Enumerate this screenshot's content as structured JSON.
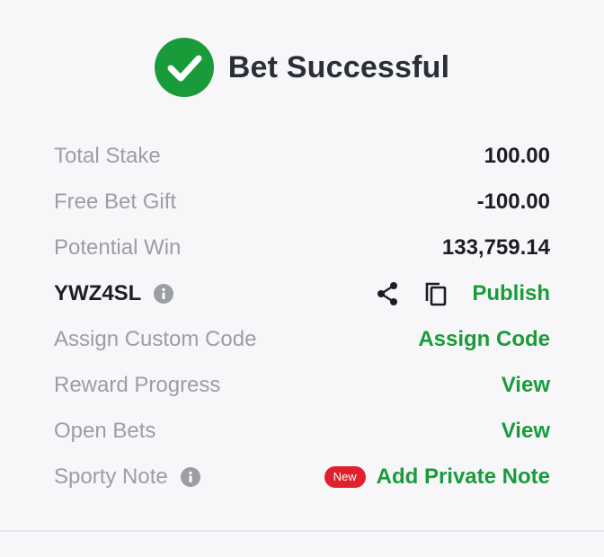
{
  "header": {
    "title": "Bet Successful"
  },
  "summary": {
    "total_stake": {
      "label": "Total Stake",
      "value": "100.00"
    },
    "free_bet_gift": {
      "label": "Free Bet Gift",
      "value": "-100.00"
    },
    "potential_win": {
      "label": "Potential Win",
      "value": "133,759.14"
    }
  },
  "booking": {
    "code": "YWZ4SL",
    "publish_label": "Publish"
  },
  "actions": {
    "custom_code": {
      "label": "Assign Custom Code",
      "action": "Assign Code"
    },
    "reward_progress": {
      "label": "Reward Progress",
      "action": "View"
    },
    "open_bets": {
      "label": "Open Bets",
      "action": "View"
    },
    "sporty_note": {
      "label": "Sporty Note",
      "badge": "New",
      "action": "Add Private Note"
    }
  },
  "colors": {
    "accent": "#1a9b3a",
    "badge": "#e0202c",
    "muted": "#9c9ea6"
  },
  "icons": [
    "check-circle-icon",
    "info-icon",
    "share-icon",
    "copy-icon"
  ]
}
